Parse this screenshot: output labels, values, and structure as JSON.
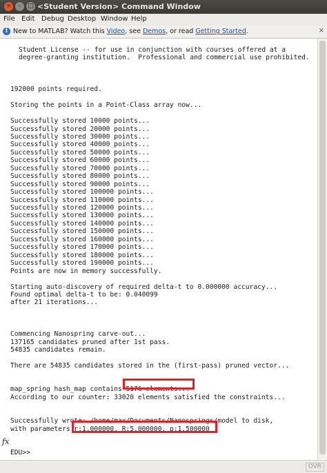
{
  "window": {
    "title": "<Student Version> Command Window",
    "close_glyph": "×",
    "minimize_glyph": "–",
    "maximize_glyph": "□"
  },
  "menu": [
    "File",
    "Edit",
    "Debug",
    "Desktop",
    "Window",
    "Help"
  ],
  "infobar": {
    "text1": "New to MATLAB? Watch this ",
    "link_video": "Video",
    "text2": ", see ",
    "link_demos": "Demos",
    "text3": ", or read ",
    "link_getting_started": "Getting Started",
    "text4": ".",
    "close_glyph": "×"
  },
  "console": {
    "lines": [
      "Student License -- for use in conjunction with courses offered at a",
      "degree-granting institution.  Professional and commercial use prohibited.",
      "",
      "",
      "",
      "192000 points required.",
      "",
      "Storing the points in a Point-Class array now...",
      "",
      "Successfully stored 10000 points...",
      "Successfully stored 20000 points...",
      "Successfully stored 30000 points...",
      "Successfully stored 40000 points...",
      "Successfully stored 50000 points...",
      "Successfully stored 60000 points...",
      "Successfully stored 70000 points...",
      "Successfully stored 80000 points...",
      "Successfully stored 90000 points...",
      "Successfully stored 100000 points...",
      "Successfully stored 110000 points...",
      "Successfully stored 120000 points...",
      "Successfully stored 130000 points...",
      "Successfully stored 140000 points...",
      "Successfully stored 150000 points...",
      "Successfully stored 160000 points...",
      "Successfully stored 170000 points...",
      "Successfully stored 180000 points...",
      "Successfully stored 190000 points...",
      "Points are now in memory successfully.",
      "",
      "Starting auto-discovery of required delta-t to 0.000000 accuracy...",
      "Found optimal delta-t to be: 0.040099",
      "after 21 iterations...",
      "",
      "",
      "",
      "Commencing Nanospring carve-out...",
      "137165 candidates pruned after 1st pass.",
      "54835 candidates remain.",
      "",
      "There are 54835 candidates stored in the (first-pass) pruned vector...",
      "",
      "",
      "map_spring hash_map contains 5176 elements...",
      "According to our counter: 33020 elements satisfied the constraints...",
      "",
      "",
      "Successfully wrote: /home/max/Documents/Nanosprings/model to disk,",
      "with parameters r:1.000000, R:5.000000, p:1.500000",
      "",
      "",
      "EDU>>"
    ]
  },
  "prompt_icon": "fx",
  "status": {
    "ovr": "OVR"
  }
}
